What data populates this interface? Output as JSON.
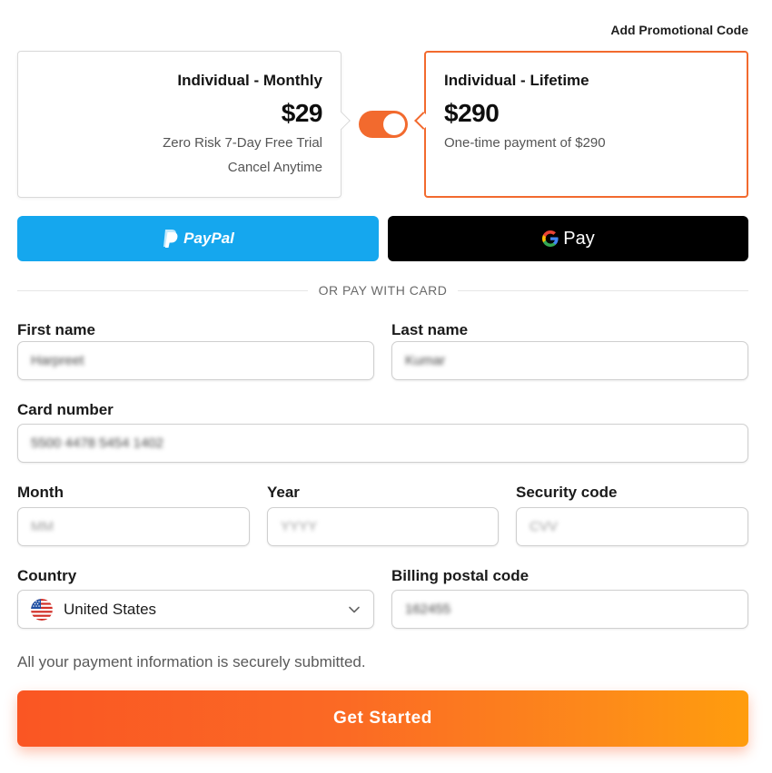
{
  "promo_link": "Add Promotional Code",
  "plans": {
    "monthly": {
      "name": "Individual - Monthly",
      "price": "$29",
      "line1": "Zero Risk 7-Day Free Trial",
      "line2": "Cancel Anytime"
    },
    "lifetime": {
      "name": "Individual - Lifetime",
      "price": "$290",
      "line1": "One-time payment of $290"
    },
    "toggle_selected": "lifetime"
  },
  "wallets": {
    "paypal_label": "PayPal",
    "gpay_label": "Pay"
  },
  "divider_text": "OR PAY WITH CARD",
  "form": {
    "first_name": {
      "label": "First name",
      "value": "Harpreet"
    },
    "last_name": {
      "label": "Last name",
      "value": "Kumar"
    },
    "card_number": {
      "label": "Card number",
      "value": "5500 4478 5454 1402"
    },
    "month": {
      "label": "Month",
      "placeholder": "MM"
    },
    "year": {
      "label": "Year",
      "placeholder": "YYYY"
    },
    "security_code": {
      "label": "Security code",
      "placeholder": "CVV"
    },
    "country": {
      "label": "Country",
      "value": "United States",
      "flag_icon": "us-flag-icon"
    },
    "postal_code": {
      "label": "Billing postal code",
      "value": "162455"
    }
  },
  "secure_note": "All your payment information is securely submitted.",
  "cta_label": "Get Started",
  "colors": {
    "accent": "#f26a2e",
    "paypal": "#15a7ee",
    "gpay": "#000000",
    "cta_start": "#fa5623",
    "cta_end": "#ff9d0d"
  }
}
